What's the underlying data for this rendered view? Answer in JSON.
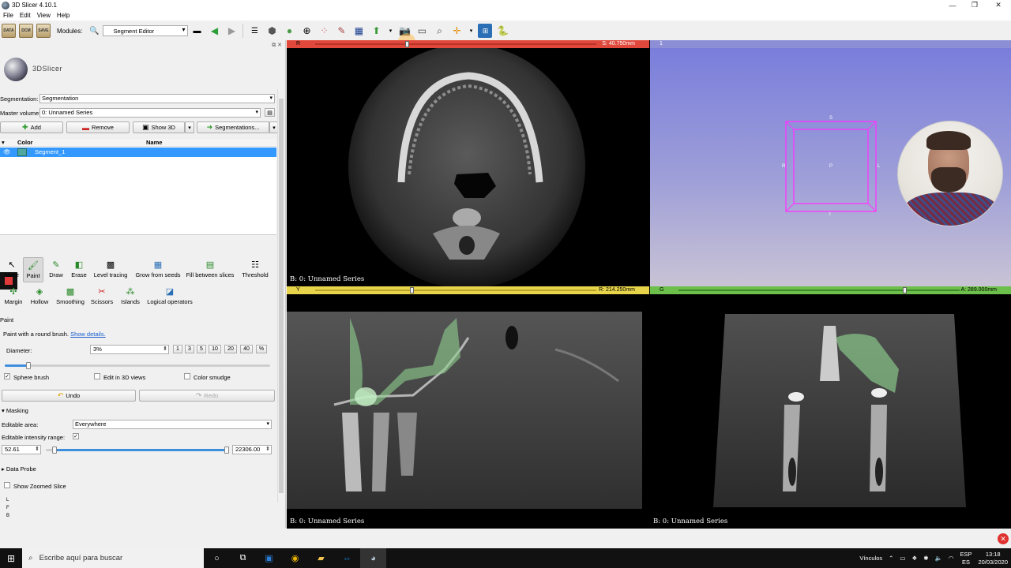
{
  "window": {
    "title": "3D Slicer 4.10.1",
    "minimize": "—",
    "restore": "❐",
    "close": "✕"
  },
  "menu": [
    "File",
    "Edit",
    "View",
    "Help"
  ],
  "toolbar": {
    "data_label": "DATA",
    "dcm_label": "DCM",
    "save_label": "SAVE",
    "modules_label": "Modules:",
    "module_value": "Segment Editor"
  },
  "left": {
    "logo_text": "3DSlicer",
    "segmentation_label": "Segmentation:",
    "segmentation_value": "Segmentation",
    "master_label": "Master volume:",
    "master_value": "0: Unnamed Series",
    "add": "Add",
    "remove": "Remove",
    "show3d": "Show 3D",
    "segmentations": "Segmentations...",
    "table": {
      "color_header": "Color",
      "name_header": "Name",
      "rows": [
        {
          "name": "Segment_1",
          "color": "#4ea8a0"
        }
      ]
    },
    "effects_row1": [
      "None",
      "Paint",
      "Draw",
      "Erase",
      "Level tracing",
      "Grow from seeds",
      "Fill between slices",
      "Threshold"
    ],
    "effects_row2": [
      "Margin",
      "Hollow",
      "Smoothing",
      "Scissors",
      "Islands",
      "Logical operators"
    ],
    "paint_section": "Paint",
    "paint_desc": "Paint with a round brush.",
    "show_details": "Show details.",
    "diameter_label": "Diameter:",
    "diameter_value": "3%",
    "diameter_presets": [
      "1",
      "3",
      "5",
      "10",
      "20",
      "40",
      "%"
    ],
    "sphere_brush": "Sphere brush",
    "edit_3d": "Edit in 3D views",
    "color_smudge": "Color smudge",
    "undo": "Undo",
    "redo": "Redo",
    "masking": "Masking",
    "editable_area_label": "Editable area:",
    "editable_area_value": "Everywhere",
    "intensity_label": "Editable intensity range:",
    "range_min": "52.61",
    "range_max": "22306.00",
    "data_probe": "Data Probe",
    "show_zoomed": "Show Zoomed Slice",
    "probe_lines": [
      "L",
      "F",
      "B"
    ]
  },
  "views": {
    "red": {
      "label": "R",
      "offset": "S: 40.750mm",
      "caption": "B: 0: Unnamed Series",
      "color": "#e0483c"
    },
    "threed": {
      "label": "1",
      "orient": {
        "S": "S",
        "R": "R",
        "L": "L",
        "P": "P",
        "I": "I"
      }
    },
    "yellow": {
      "label": "Y",
      "offset": "R: 214.250mm",
      "caption": "B: 0: Unnamed Series",
      "color": "#e8d44a"
    },
    "green": {
      "label": "G",
      "offset": "A: 289.000mm",
      "caption": "B: 0: Unnamed Series",
      "color": "#6cbf4a"
    }
  },
  "taskbar": {
    "search_placeholder": "Escribe aquí para buscar",
    "links": "Vínculos",
    "lang_top": "ESP",
    "lang_bottom": "ES",
    "time": "13:18",
    "date": "20/03/2020"
  }
}
